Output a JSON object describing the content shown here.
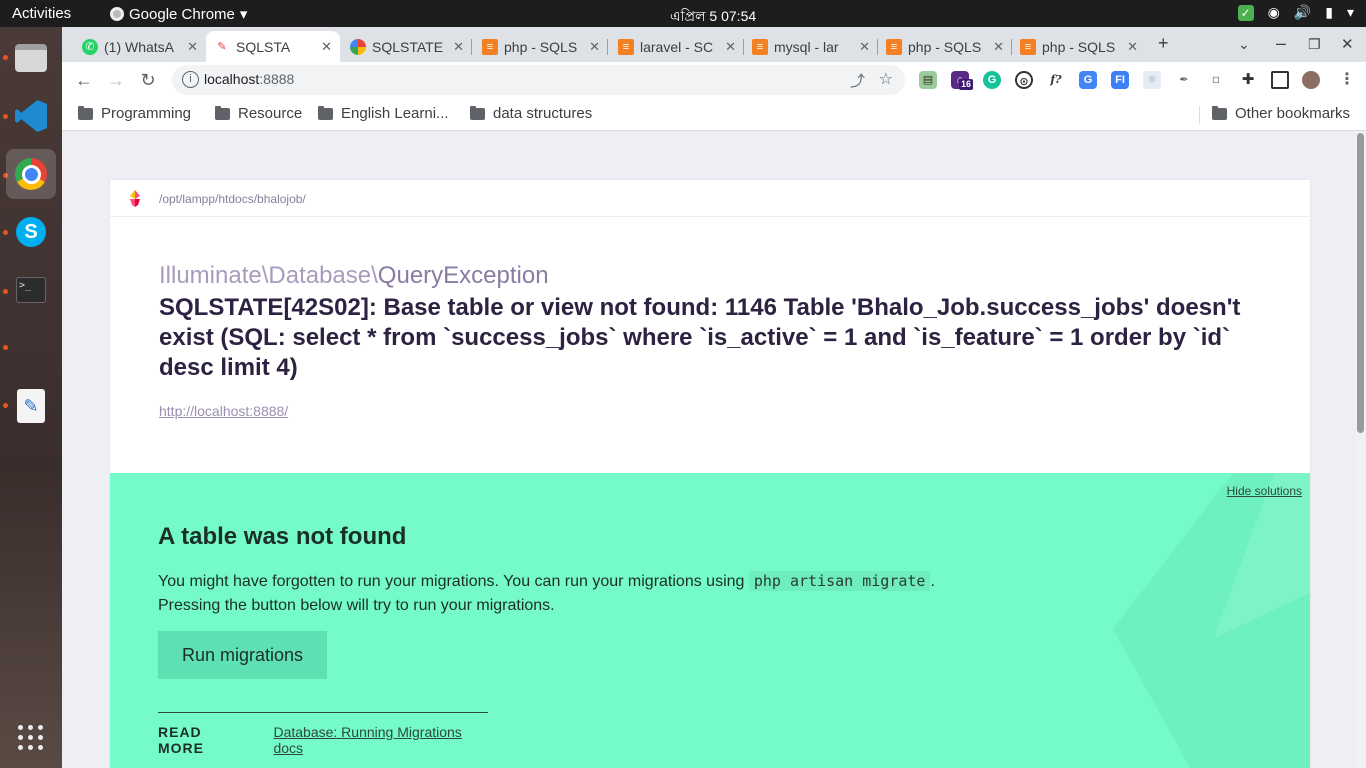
{
  "topbar": {
    "activities": "Activities",
    "app_name": "Google Chrome",
    "clock": "এপ্রিল 5  07:54"
  },
  "dock": {
    "items": [
      "files-icon",
      "vscode-icon",
      "chrome-icon",
      "skype-icon",
      "terminal-icon",
      "text-editor-icon",
      "app-grid-icon"
    ]
  },
  "tabs": [
    {
      "label": "(1) WhatsA",
      "icon": "whatsapp-icon"
    },
    {
      "label": "SQLSTA",
      "icon": "ignition-icon",
      "active": true
    },
    {
      "label": "SQLSTATE",
      "icon": "google-icon"
    },
    {
      "label": "php - SQLS",
      "icon": "stackoverflow-icon"
    },
    {
      "label": "laravel - SC",
      "icon": "stackoverflow-icon"
    },
    {
      "label": "mysql - lar",
      "icon": "stackoverflow-icon"
    },
    {
      "label": "php - SQLS",
      "icon": "stackoverflow-icon"
    },
    {
      "label": "php - SQLS",
      "icon": "stackoverflow-icon"
    }
  ],
  "toolbar": {
    "url_host": "localhost",
    "url_port": ":8888",
    "ext_badge": "16"
  },
  "bookmarks": {
    "items": [
      "Programming",
      "Resource",
      "English Learni...",
      "data structures"
    ],
    "other": "Other bookmarks"
  },
  "page": {
    "path": "/opt/lampp/htdocs/bhalojob/",
    "exception_namespace": "Illuminate\\Database\\",
    "exception_class": "QueryException",
    "message": "SQLSTATE[42S02]: Base table or view not found: 1146 Table 'Bhalo_Job.success_jobs' doesn't exist (SQL: select * from `success_jobs` where `is_active` = 1 and `is_feature` = 1 order by `id` desc limit 4)",
    "url": "http://localhost:8888/"
  },
  "solution": {
    "hide_label": "Hide solutions",
    "title": "A table was not found",
    "desc_part1": "You might have forgotten to run your migrations. You can run your migrations using ",
    "desc_code": "php artisan migrate",
    "desc_part2": ".",
    "desc_line2": "Pressing the button below will try to run your migrations.",
    "button": "Run migrations",
    "read_more": "READ MORE",
    "doc_link": "Database: Running Migrations docs"
  },
  "colors": {
    "solution_bg": "#75fbc7",
    "button_bg": "#5fe0b3",
    "message_text": "#2d2241",
    "ubuntu_accent": "#e95420"
  }
}
